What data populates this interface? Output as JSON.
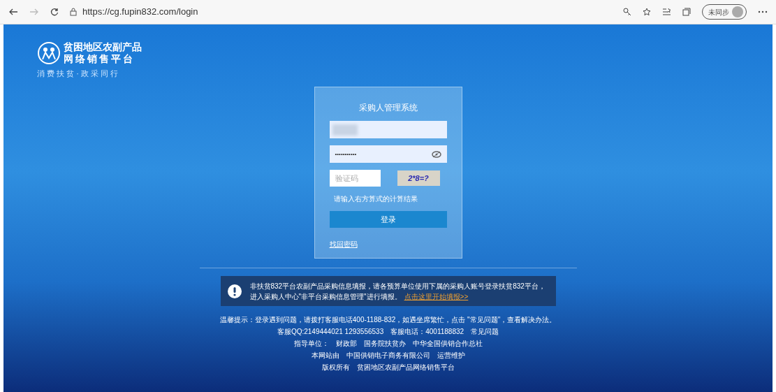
{
  "browser": {
    "url": "https://cg.fupin832.com/login",
    "profile": "未同步"
  },
  "logo": {
    "title_line_1": "贫困地区农副产品",
    "title_line_2": "网络销售平台",
    "slogan": "消 费 扶 贫 · 政 采 同 行"
  },
  "login": {
    "title": "采购人管理系统",
    "password": {
      "value": "•••••••••••"
    },
    "captcha": {
      "placeholder": "验证码",
      "image_text": "2*8=?"
    },
    "hint": "请输入右方算式的计算结果",
    "submit": "登录",
    "forgot": "找回密码"
  },
  "notice": {
    "text_line_1": "非扶贫832平台农副产品采购信息填报，请各预算单位使用下属的采购人账号登录扶贫832平台，",
    "text_line_2": "进入采购人中心\"非平台采购信息管理\"进行填报。",
    "link": "点击这里开始填报>>"
  },
  "footer": [
    {
      "parts": [
        "温馨提示：登录遇到问题，请拨打客服电话400-1188-832，如遇坐席繁忙，点击 \"常见问题\"，查看解决办法。"
      ]
    },
    {
      "parts": [
        "客服QQ:2149444021 1293556533",
        "客服电话：4001188832",
        "常见问题"
      ]
    },
    {
      "parts": [
        "指导单位：",
        "财政部",
        "国务院扶贫办",
        "中华全国供销合作总社"
      ]
    },
    {
      "parts": [
        "本网站由",
        "中国供销电子商务有限公司",
        "运营维护"
      ]
    },
    {
      "parts": [
        "版权所有",
        "贫困地区农副产品网络销售平台"
      ]
    }
  ]
}
